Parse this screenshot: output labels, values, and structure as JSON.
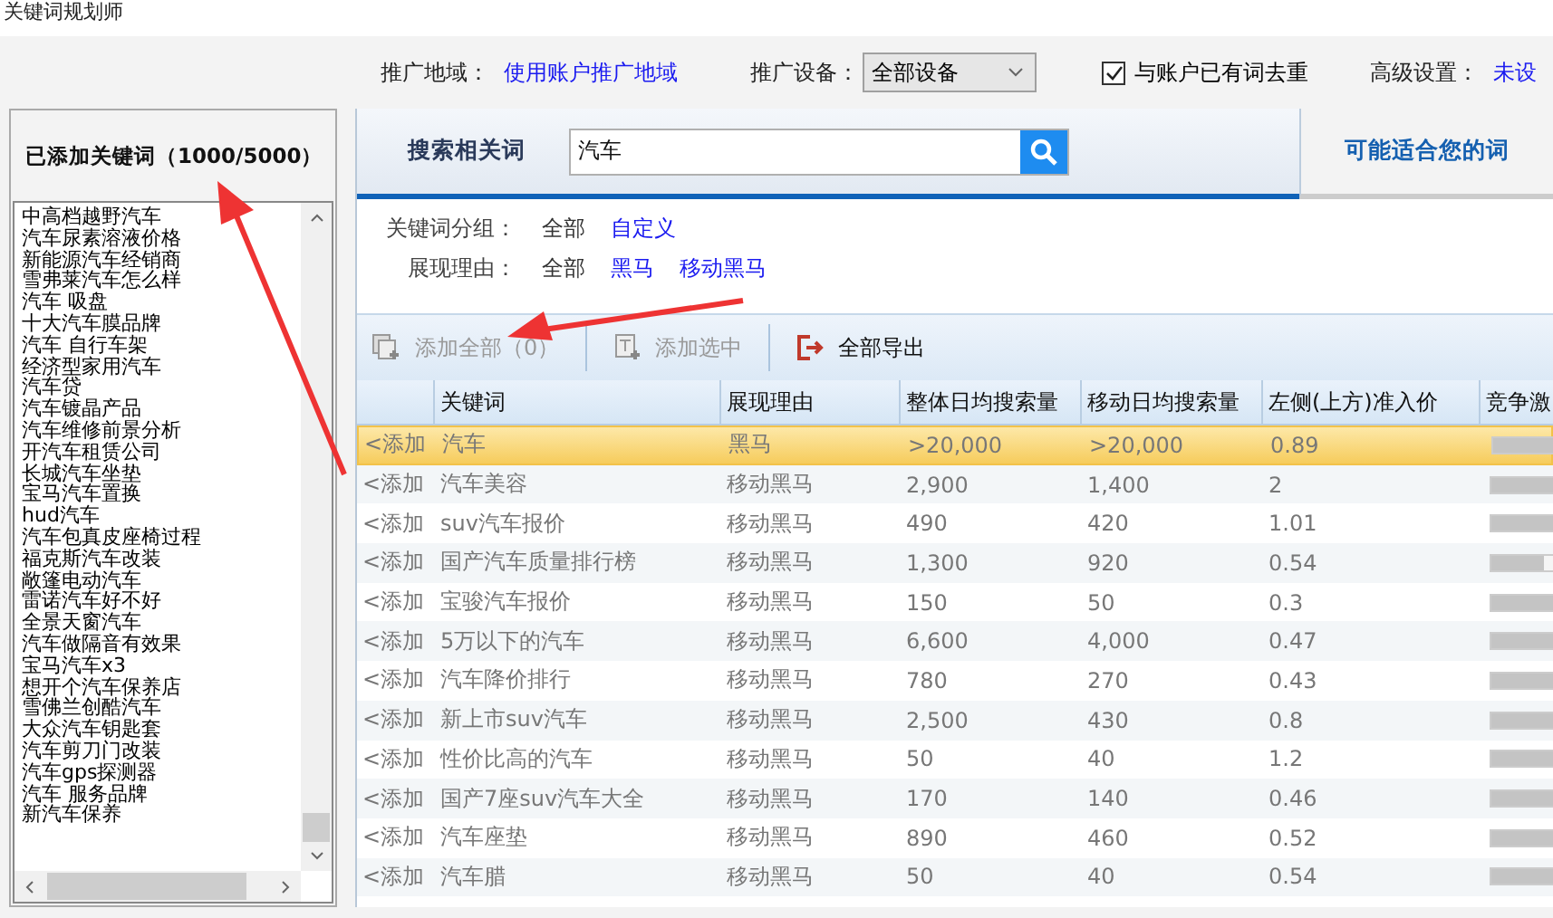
{
  "window": {
    "title": "关键词规划师"
  },
  "settings": {
    "region_label": "推广地域：",
    "region_value": "使用账户推广地域",
    "device_label": "推广设备：",
    "device_value": "全部设备",
    "dedupe": {
      "label": "与账户已有词去重",
      "checked": true
    },
    "advanced_label": "高级设置：",
    "advanced_value": "未设"
  },
  "added_panel": {
    "title": "已添加关键词（1000/5000）",
    "items": [
      "中高档越野汽车",
      "汽车尿素溶液价格",
      "新能源汽车经销商",
      "雪弗莱汽车怎么样",
      "汽车 吸盘",
      "十大汽车膜品牌",
      "汽车 自行车架",
      "经济型家用汽车",
      "汽车贷",
      "汽车镀晶产品",
      "汽车维修前景分析",
      "开汽车租赁公司",
      "长城汽车坐垫",
      "宝马汽车置换",
      "hud汽车",
      "汽车包真皮座椅过程",
      "福克斯汽车改装",
      "敞篷电动汽车",
      "雷诺汽车好不好",
      "全景天窗汽车",
      "汽车做隔音有效果",
      "宝马汽车x3",
      "想开个汽车保养店",
      "雪佛兰创酷汽车",
      "大众汽车钥匙套",
      "汽车剪刀门改装",
      "汽车gps探测器",
      "汽车 服务品牌",
      "新汽车保养"
    ]
  },
  "tabs": [
    {
      "label": "搜索相关词",
      "selected": true
    },
    {
      "label": "可能适合您的词",
      "selected": false
    }
  ],
  "search": {
    "value": "汽车"
  },
  "filters": [
    {
      "label": "关键词分组：",
      "options": [
        {
          "text": "全部",
          "selected": true
        },
        {
          "text": "自定义",
          "selected": false
        }
      ]
    },
    {
      "label": "展现理由：",
      "options": [
        {
          "text": "全部",
          "selected": true
        },
        {
          "text": "黑马",
          "selected": false
        },
        {
          "text": "移动黑马",
          "selected": false
        }
      ]
    }
  ],
  "actions": [
    {
      "label": "添加全部（0）",
      "disabled": true,
      "kind": "add-all"
    },
    {
      "label": "添加选中",
      "disabled": true,
      "kind": "add-selected"
    },
    {
      "label": "全部导出",
      "disabled": false,
      "kind": "export"
    }
  ],
  "table": {
    "columns": [
      "关键词",
      "展现理由",
      "整体日均搜索量",
      "移动日均搜索量",
      "左侧(上方)准入价",
      "竞争激"
    ],
    "rows": [
      {
        "add": "<添加",
        "keyword": "汽车",
        "reason": "黑马",
        "overall": ">20,000",
        "mobile": ">20,000",
        "price": "0.89",
        "level": 1,
        "selected": true
      },
      {
        "add": "<添加",
        "keyword": "汽车美容",
        "reason": "移动黑马",
        "overall": "2,900",
        "mobile": "1,400",
        "price": "2",
        "level": 0.75,
        "selected": false
      },
      {
        "add": "<添加",
        "keyword": "suv汽车报价",
        "reason": "移动黑马",
        "overall": "490",
        "mobile": "420",
        "price": "1.01",
        "level": 0.65,
        "selected": false
      },
      {
        "add": "<添加",
        "keyword": "国产汽车质量排行榜",
        "reason": "移动黑马",
        "overall": "1,300",
        "mobile": "920",
        "price": "0.54",
        "level": 0.5,
        "selected": false
      },
      {
        "add": "<添加",
        "keyword": "宝骏汽车报价",
        "reason": "移动黑马",
        "overall": "150",
        "mobile": "50",
        "price": "0.3",
        "level": 1,
        "selected": false
      },
      {
        "add": "<添加",
        "keyword": "5万以下的汽车",
        "reason": "移动黑马",
        "overall": "6,600",
        "mobile": "4,000",
        "price": "0.47",
        "level": 0.75,
        "selected": false
      },
      {
        "add": "<添加",
        "keyword": "汽车降价排行",
        "reason": "移动黑马",
        "overall": "780",
        "mobile": "270",
        "price": "0.43",
        "level": 0.95,
        "selected": false
      },
      {
        "add": "<添加",
        "keyword": "新上市suv汽车",
        "reason": "移动黑马",
        "overall": "2,500",
        "mobile": "430",
        "price": "0.8",
        "level": 0.75,
        "selected": false
      },
      {
        "add": "<添加",
        "keyword": "性价比高的汽车",
        "reason": "移动黑马",
        "overall": "50",
        "mobile": "40",
        "price": "1.2",
        "level": 0.6,
        "selected": false
      },
      {
        "add": "<添加",
        "keyword": "国产7座suv汽车大全",
        "reason": "移动黑马",
        "overall": "170",
        "mobile": "140",
        "price": "0.46",
        "level": 0.75,
        "selected": false
      },
      {
        "add": "<添加",
        "keyword": "汽车座垫",
        "reason": "移动黑马",
        "overall": "890",
        "mobile": "460",
        "price": "0.52",
        "level": 0.75,
        "selected": false
      },
      {
        "add": "<添加",
        "keyword": "汽车腊",
        "reason": "移动黑马",
        "overall": "50",
        "mobile": "40",
        "price": "0.54",
        "level": 0.6,
        "selected": false
      }
    ]
  }
}
